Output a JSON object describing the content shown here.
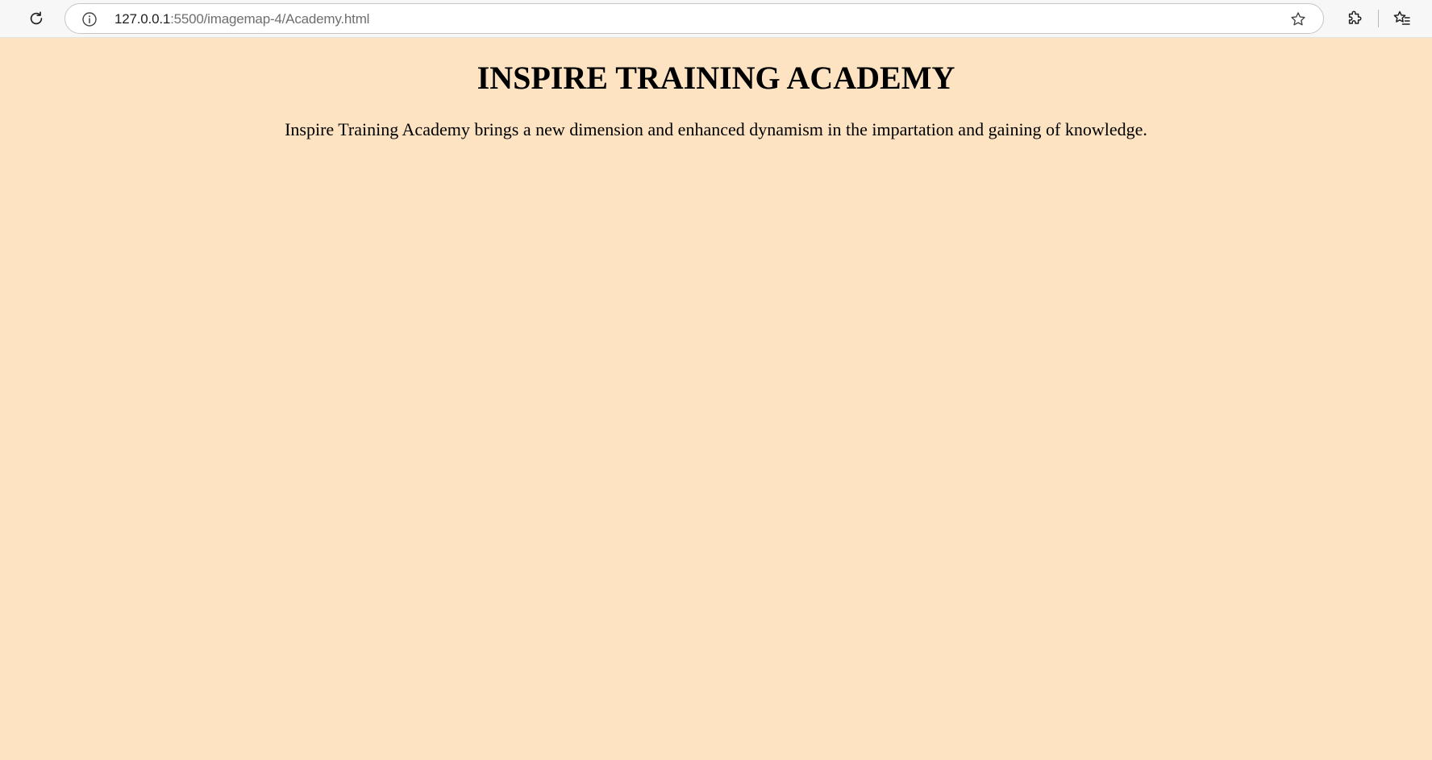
{
  "browser": {
    "url_host": "127.0.0.1",
    "url_rest": ":5500/imagemap-4/Academy.html",
    "icons": {
      "reload": "reload-icon",
      "info": "info-icon",
      "star": "star-icon",
      "extensions": "puzzle-icon",
      "favorites": "favorites-icon"
    }
  },
  "page": {
    "title": "INSPIRE TRAINING ACADEMY",
    "intro": "Inspire Training Academy brings a new dimension and enhanced dynamism in the impartation and gaining of knowledge.",
    "background_color": "#fde3c2"
  }
}
